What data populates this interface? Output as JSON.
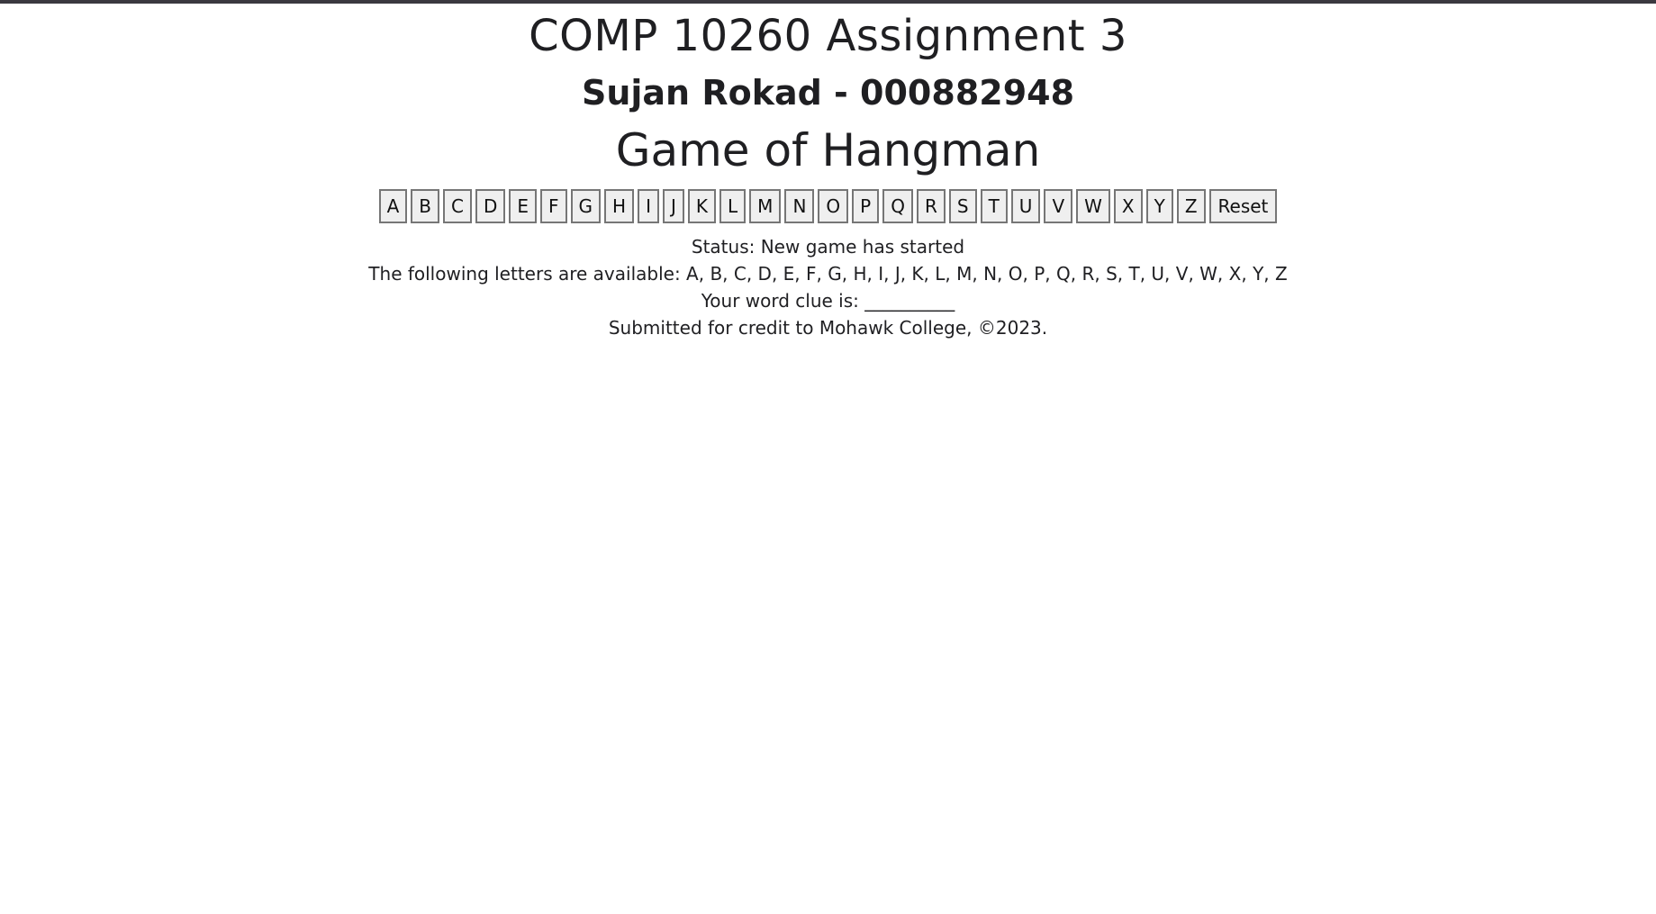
{
  "header": {
    "course_title": "COMP 10260 Assignment 3",
    "author": "Sujan Rokad - 000882948",
    "game_title": "Game of Hangman"
  },
  "letters": [
    "A",
    "B",
    "C",
    "D",
    "E",
    "F",
    "G",
    "H",
    "I",
    "J",
    "K",
    "L",
    "M",
    "N",
    "O",
    "P",
    "Q",
    "R",
    "S",
    "T",
    "U",
    "V",
    "W",
    "X",
    "Y",
    "Z"
  ],
  "reset_label": "Reset",
  "status_text": "Status: New game has started",
  "available_text": "The following letters are available: A, B, C, D, E, F, G, H, I, J, K, L, M, N, O, P, Q, R, S, T, U, V, W, X, Y, Z",
  "clue_text": "Your word clue is: __________",
  "footer_text": "Submitted for credit to Mohawk College, ©2023.",
  "colors": {
    "topbar": "#3b3940",
    "button_bg": "#efefef",
    "button_border": "#767676",
    "text": "#1f1f22"
  }
}
